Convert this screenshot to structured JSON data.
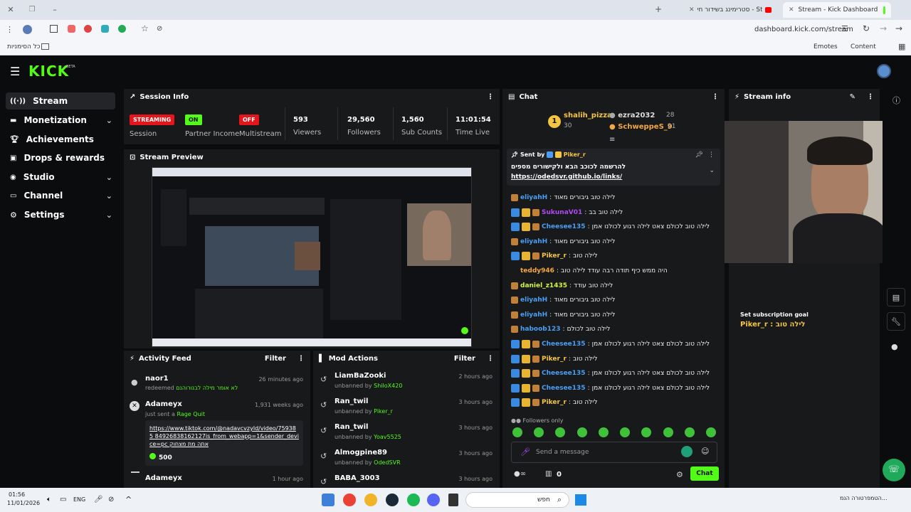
{
  "browser": {
    "tabs": [
      {
        "title": "Stream - Kick Dashboard",
        "active": true
      },
      {
        "title": "סטרימינג בשידור חי - Studio",
        "active": false
      }
    ],
    "url": "dashboard.kick.com/stream",
    "bookmarks_label": "כל הסימניות",
    "right_links": [
      "Emotes",
      "Content"
    ]
  },
  "app": {
    "logo": "KICK",
    "beta": "BETA",
    "sidebar": [
      {
        "label": "Stream",
        "icon": "stream-icon",
        "chev": false,
        "active": true
      },
      {
        "label": "Monetization",
        "icon": "monetization-icon",
        "chev": true
      },
      {
        "label": "Achievements",
        "icon": "trophy-icon",
        "chev": false
      },
      {
        "label": "Drops & rewards",
        "icon": "gift-icon",
        "chev": false
      },
      {
        "label": "Studio",
        "icon": "studio-icon",
        "chev": true
      },
      {
        "label": "Channel",
        "icon": "channel-icon",
        "chev": true
      },
      {
        "label": "Settings",
        "icon": "gear-icon",
        "chev": true
      }
    ],
    "session": {
      "title": "Session Info",
      "items": [
        {
          "badge": "STREAMING",
          "label": "Session",
          "color": "#e4161c"
        },
        {
          "badge": "ON",
          "label": "Partner Income",
          "color": "#53fc18"
        },
        {
          "badge": "OFF",
          "label": "Multistream",
          "color": "#e4161c"
        },
        {
          "value": "593",
          "label": "Viewers"
        },
        {
          "value": "29,560",
          "label": "Followers"
        },
        {
          "value": "1,560",
          "label": "Sub Counts"
        },
        {
          "value": "11:01:54",
          "label": "Time Live"
        }
      ]
    },
    "preview": {
      "title": "Stream Preview"
    },
    "activity": {
      "title": "Activity Feed",
      "filter": "Filter",
      "items": [
        {
          "user": "naor1",
          "action": "redeemed",
          "highlight": "לא אומר מילה לבנורוהנם",
          "time": "26 minutes ago"
        },
        {
          "user": "Adameyx",
          "action": "just sent a",
          "highlight": "Rage Quit",
          "time": "1,931 weeks ago",
          "link": "https://www.tiktok.com/@nadavcvzyld/video/759385 84926838162127is_from_webapp=1&sender_device=pc",
          "link_suffix": "אתה מת מצחוק",
          "amount": "500"
        },
        {
          "user": "Adameyx",
          "time": "1 hour ago"
        }
      ]
    },
    "mod": {
      "title": "Mod Actions",
      "filter": "Filter",
      "items": [
        {
          "user": "LiamBaZooki",
          "by": "ShiloX420",
          "time": "2 hours ago"
        },
        {
          "user": "Ran_twil",
          "by": "Piker_r",
          "time": "3 hours ago"
        },
        {
          "user": "Ran_twil",
          "by": "Yoav5525",
          "time": "3 hours ago"
        },
        {
          "user": "Almogpine89",
          "by": "OdedSVR",
          "time": "3 hours ago"
        },
        {
          "user": "BABA_3003",
          "by": "",
          "time": "3 hours ago"
        }
      ],
      "unbanned": "unbanned by"
    },
    "chat": {
      "title": "Chat",
      "top": [
        {
          "name": "shalih_pizza",
          "count": "30"
        },
        {
          "name": "ezra2032",
          "count": "28"
        },
        {
          "name": "SchweppeS_9",
          "count": "21"
        }
      ],
      "pinned_by": "Sent by",
      "pinned_user": "Piker_r",
      "pinned_text": "להרשמה לכוכב הבא ולקישורים מספים",
      "pinned_link": "https://odedsvr.github.io/links/",
      "messages": [
        {
          "user": "eliyahH",
          "color": "#4a9ff5",
          "text": "לילה טוב גיבורים מאוד"
        },
        {
          "user": "SukunaV01",
          "color": "#b04af5",
          "text": "לילה טוב בב"
        },
        {
          "user": "Cheesee135",
          "color": "#4a9ff5",
          "text": "לילה טוב לכולם צאט לילה רגוע לכולנו אמן"
        },
        {
          "user": "eliyahH",
          "color": "#4a9ff5",
          "text": "לילה טוב גיבורים מאוד"
        },
        {
          "user": "Piker_r",
          "color": "#f5c542",
          "text": "לילה טוב"
        },
        {
          "user": "teddy946",
          "color": "#f5a742",
          "text": "היה ממש כיף תודה רבה עודד לילה טוב"
        },
        {
          "user": "daniel_z1435",
          "color": "#d0f542",
          "text": "לילה טוב עודד"
        },
        {
          "user": "eliyahH",
          "color": "#4a9ff5",
          "text": "לילה טוב גיבורים מאוד"
        },
        {
          "user": "eliyahH",
          "color": "#4a9ff5",
          "text": "לילה טוב גיבורים מאוד"
        },
        {
          "user": "haboob123",
          "color": "#4a9ff5",
          "text": "לילה טוב לכולם"
        },
        {
          "user": "Cheesee135",
          "color": "#4a9ff5",
          "text": "לילה טוב לכולם צאט לילה רגוע לכולנו אמן"
        },
        {
          "user": "Piker_r",
          "color": "#f5c542",
          "text": "לילה טוב"
        },
        {
          "user": "Cheesee135",
          "color": "#4a9ff5",
          "text": "לילה טוב לכולם צאט לילה רגוע לכולנו אמן"
        },
        {
          "user": "Cheesee135",
          "color": "#4a9ff5",
          "text": "לילה טוב לכולם צאט לילה רגוע לכולנו אמן"
        },
        {
          "user": "Piker_r",
          "color": "#f5c542",
          "text": "לילה טוב"
        }
      ],
      "followers_only": "Followers only",
      "placeholder": "Send a message",
      "count": "0",
      "send": "Chat"
    },
    "streaminfo": {
      "title": "Stream info",
      "overlay1": "Set subscription goal",
      "overlay2": "Piker_r : לילה טוב"
    }
  },
  "taskbar": {
    "time": "01:56",
    "date": "11/01/2026",
    "lang": "ENG",
    "search": "חפש",
    "news": "הטמפרטורה הנמ..."
  }
}
